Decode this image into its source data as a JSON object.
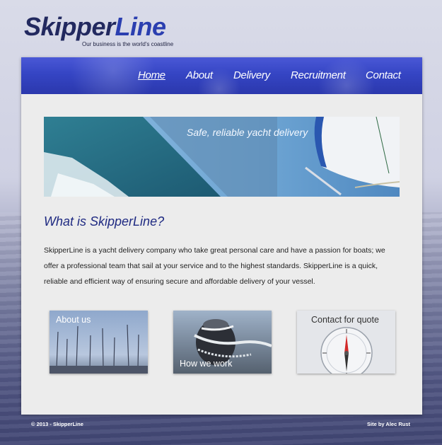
{
  "brand": {
    "name_part1": "Skipper",
    "name_part2": "Line",
    "tagline": "Our business is the world's coastline"
  },
  "nav": {
    "items": [
      {
        "label": "Home",
        "active": true
      },
      {
        "label": "About"
      },
      {
        "label": "Delivery"
      },
      {
        "label": "Recruitment"
      },
      {
        "label": "Contact"
      }
    ]
  },
  "banner": {
    "caption": "Safe, reliable yacht delivery"
  },
  "intro": {
    "heading": "What is SkipperLine?",
    "body": "SkipperLine is a yacht delivery company who take great personal care and have a passion for boats; we offer a professional team that sail at your service and to the highest standards. SkipperLine is a quick, reliable and efficient way of ensuring secure and affordable delivery of your vessel."
  },
  "tiles": [
    {
      "label": "About us"
    },
    {
      "label": "How we work"
    },
    {
      "label": "Contact for quote"
    }
  ],
  "footer": {
    "copyright": "© 2013 - SkipperLine",
    "credit": "Site by Alec Rust"
  },
  "colors": {
    "brand_dark": "#22295f",
    "brand_accent": "#2b3fb0",
    "nav_blue": "#3545c4",
    "heading_blue": "#1f2a82",
    "card_bg": "#ececec"
  }
}
